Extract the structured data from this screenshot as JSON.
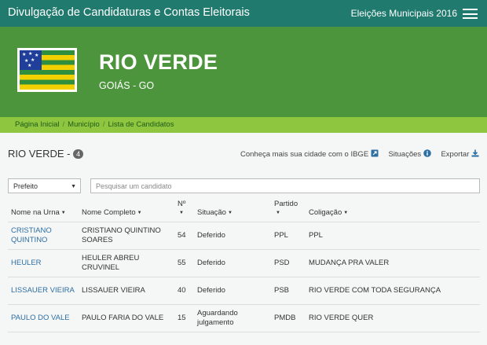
{
  "header": {
    "app_title": "Divulgação de Candidaturas e Contas Eleitorais",
    "election": "Eleições Municipais 2016",
    "menu_icon": "hamburger-menu-icon",
    "colors": {
      "topbar": "#217a6e",
      "hero": "#4d953d",
      "breadcrumb_bar": "#8ec63f"
    }
  },
  "hero": {
    "city": "RIO VERDE",
    "state": "GOIÁS - GO",
    "flag": "goias-state-flag"
  },
  "breadcrumb": [
    "Página Inicial",
    "Município",
    "Lista de Candidatos"
  ],
  "section": {
    "title": "RIO VERDE -",
    "count": "4",
    "ibge_link": "Conheça mais sua cidade com o IBGE",
    "ibge_icon": "external-link-icon",
    "situations_link": "Situações",
    "situations_icon": "info-circle-icon",
    "export_link": "Exportar",
    "export_icon": "download-icon"
  },
  "filters": {
    "office_selected": "Prefeito",
    "search_placeholder": "Pesquisar um candidato"
  },
  "table": {
    "columns": [
      "Nome na Urna",
      "Nome Completo",
      "Nº",
      "Situação",
      "Partido",
      "Coligação"
    ],
    "rows": [
      {
        "urna": "CRISTIANO QUINTINO",
        "completo": "CRISTIANO QUINTINO SOARES",
        "numero": "54",
        "situacao": "Deferido",
        "partido": "PPL",
        "coligacao": "PPL"
      },
      {
        "urna": "HEULER",
        "completo": "HEULER ABREU CRUVINEL",
        "numero": "55",
        "situacao": "Deferido",
        "partido": "PSD",
        "coligacao": "MUDANÇA PRA VALER"
      },
      {
        "urna": "LISSAUER VIEIRA",
        "completo": "LISSAUER VIEIRA",
        "numero": "40",
        "situacao": "Deferido",
        "partido": "PSB",
        "coligacao": "RIO VERDE COM TODA SEGURANÇA"
      },
      {
        "urna": "PAULO DO VALE",
        "completo": "PAULO FARIA DO VALE",
        "numero": "15",
        "situacao": "Aguardando julgamento",
        "partido": "PMDB",
        "coligacao": "RIO VERDE QUER"
      }
    ]
  }
}
